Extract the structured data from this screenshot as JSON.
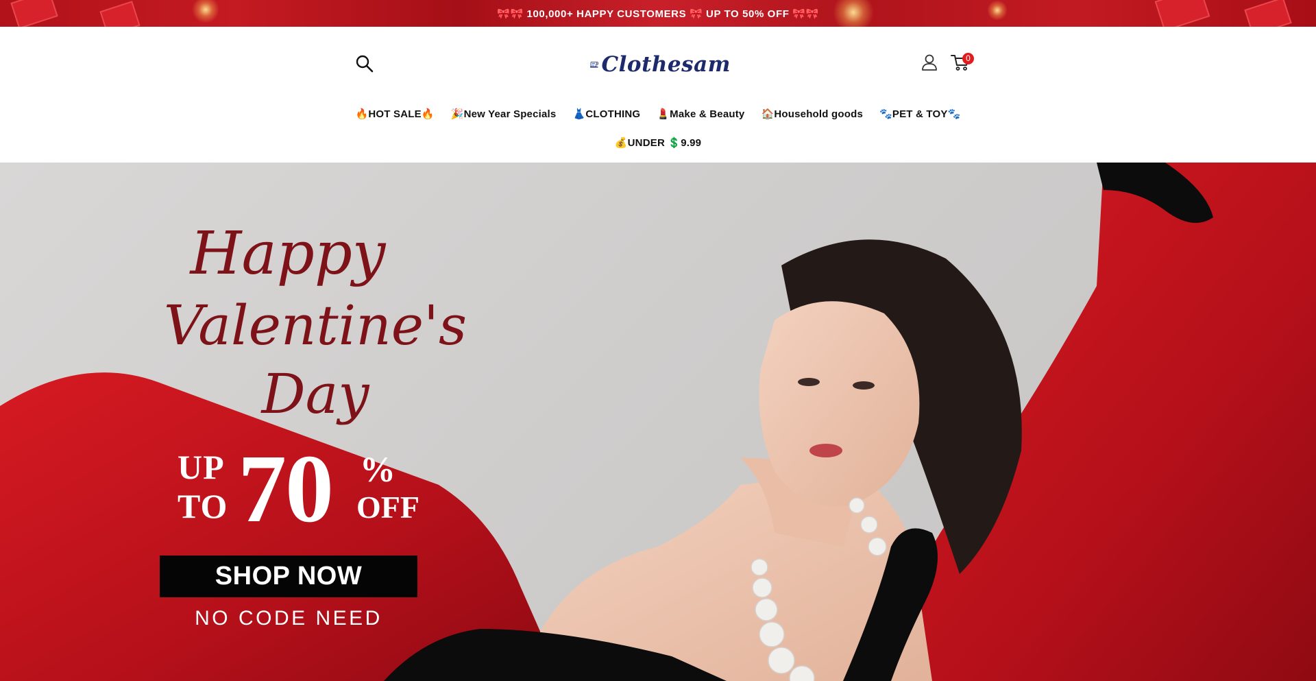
{
  "announcement": {
    "text": "🎀🎀 100,000+ HAPPY CUSTOMERS 🎀 UP TO 50% OFF 🎀🎀"
  },
  "header": {
    "logo_text": "Clothesam",
    "cart_count": "0",
    "icons": [
      "search-icon",
      "sewing-machine-logo",
      "account-icon",
      "cart-icon"
    ]
  },
  "nav": {
    "row1": [
      "🔥HOT SALE🔥",
      "🎉New Year Specials",
      "👗CLOTHING",
      "💄Make & Beauty",
      "🏠Household goods",
      "🐾PET & TOY🐾"
    ],
    "row2": [
      "💰UNDER 💲9.99"
    ]
  },
  "hero": {
    "title_line1": "Happy",
    "title_line2": "Valentine's Day",
    "promo_up": "UP",
    "promo_to": "TO",
    "promo_number": "70",
    "promo_percent": "%",
    "promo_off": "OFF",
    "cta_label": "SHOP NOW",
    "cta_note": "NO CODE NEED"
  },
  "colors": {
    "announcement_red": "#b8141c",
    "accent_red": "#7d1218",
    "cart_badge": "#e21c1c",
    "cta_black": "#050505",
    "logo_navy": "#1d2a6b"
  }
}
